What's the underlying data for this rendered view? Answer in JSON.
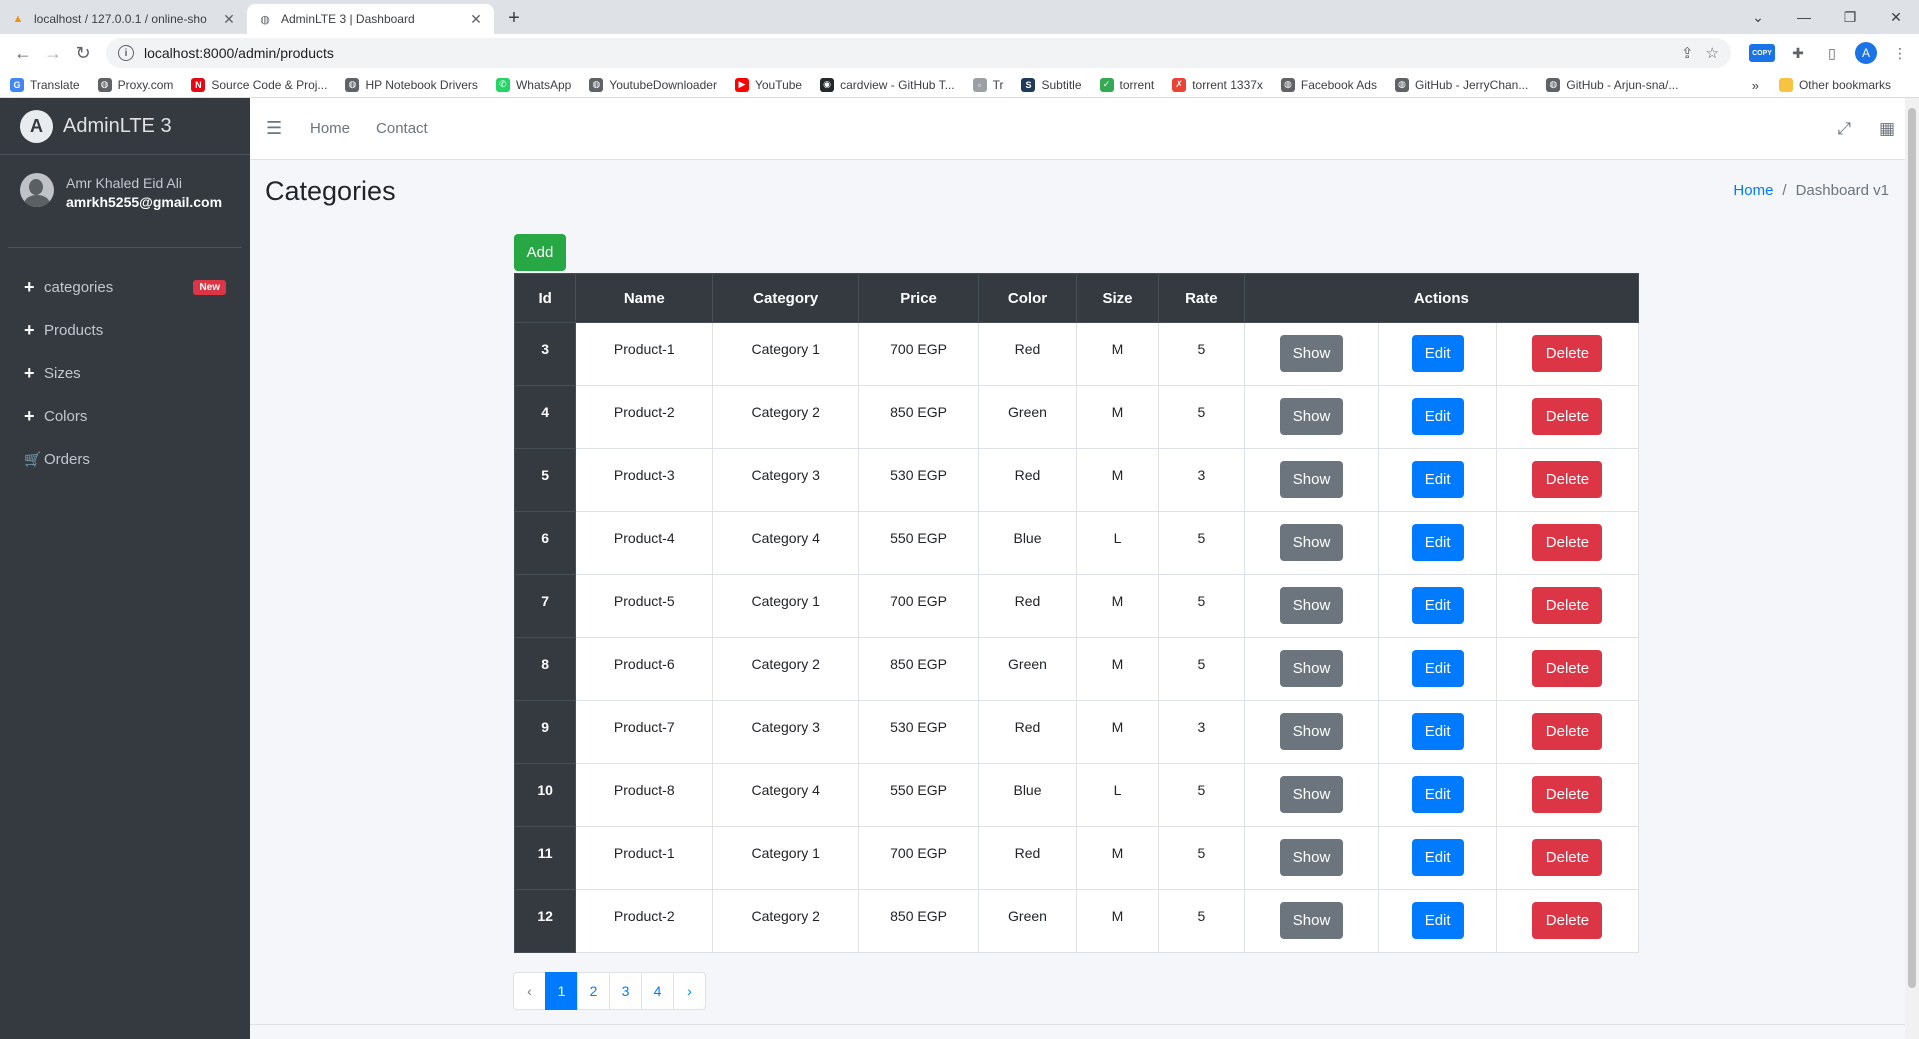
{
  "browser": {
    "tabs": [
      {
        "title": "localhost / 127.0.0.1 / online-sho",
        "active": false
      },
      {
        "title": "AdminLTE 3 | Dashboard",
        "active": true
      }
    ],
    "new_tab": "+",
    "url": "localhost:8000/admin/products",
    "bookmarks": [
      {
        "label": "Translate",
        "icon": "translate-icon",
        "color": "#4285f4"
      },
      {
        "label": "Proxy.com",
        "icon": "globe-icon",
        "color": "#5f6368"
      },
      {
        "label": "Source Code & Proj...",
        "icon": "netflix-icon",
        "color": "#e50914"
      },
      {
        "label": "HP Notebook Drivers",
        "icon": "globe-icon",
        "color": "#5f6368"
      },
      {
        "label": "WhatsApp",
        "icon": "whatsapp-icon",
        "color": "#25d366"
      },
      {
        "label": "YoutubeDownloader",
        "icon": "globe-icon",
        "color": "#5f6368"
      },
      {
        "label": "YouTube",
        "icon": "youtube-icon",
        "color": "#ff0000"
      },
      {
        "label": "cardview - GitHub T...",
        "icon": "github-icon",
        "color": "#24292e"
      },
      {
        "label": "Tr",
        "icon": "page-icon",
        "color": "#9aa0a6"
      },
      {
        "label": "Subtitle",
        "icon": "subtitle-icon",
        "color": "#1f3b57"
      },
      {
        "label": "torrent",
        "icon": "checkbox-icon",
        "color": "#34a853"
      },
      {
        "label": "torrent 1337x",
        "icon": "x-icon",
        "color": "#ea4335"
      },
      {
        "label": "Facebook Ads",
        "icon": "globe-icon",
        "color": "#5f6368"
      },
      {
        "label": "GitHub - JerryChan...",
        "icon": "globe-icon",
        "color": "#5f6368"
      },
      {
        "label": "GitHub - Arjun-sna/...",
        "icon": "globe-icon",
        "color": "#5f6368"
      }
    ],
    "bookmarks_more": "»",
    "other_bookmarks": "Other bookmarks",
    "profile_initial": "A",
    "copy_ext": "COPY"
  },
  "sidebar": {
    "brand": "AdminLTE 3",
    "brand_logo": "A",
    "user_name": "Amr Khaled Eid Ali",
    "user_email": "amrkh5255@gmail.com",
    "items": [
      {
        "label": "categories",
        "icon": "+",
        "badge": "New"
      },
      {
        "label": "Products",
        "icon": "+"
      },
      {
        "label": "Sizes",
        "icon": "+"
      },
      {
        "label": "Colors",
        "icon": "+"
      },
      {
        "label": "Orders",
        "icon": "🛒"
      }
    ]
  },
  "topnav": {
    "menu_icon": "☰",
    "links": [
      "Home",
      "Contact"
    ]
  },
  "page": {
    "title": "Categories",
    "breadcrumb": {
      "home": "Home",
      "separator": "/",
      "current": "Dashboard v1"
    },
    "add_label": "Add"
  },
  "table": {
    "headers": [
      "Id",
      "Name",
      "Category",
      "Price",
      "Color",
      "Size",
      "Rate",
      "Actions"
    ],
    "actions": {
      "show": "Show",
      "edit": "Edit",
      "delete": "Delete"
    },
    "rows": [
      {
        "id": "3",
        "name": "Product-1",
        "category": "Category 1",
        "price": "700 EGP",
        "color": "Red",
        "size": "M",
        "rate": "5"
      },
      {
        "id": "4",
        "name": "Product-2",
        "category": "Category 2",
        "price": "850 EGP",
        "color": "Green",
        "size": "M",
        "rate": "5"
      },
      {
        "id": "5",
        "name": "Product-3",
        "category": "Category 3",
        "price": "530 EGP",
        "color": "Red",
        "size": "M",
        "rate": "3"
      },
      {
        "id": "6",
        "name": "Product-4",
        "category": "Category 4",
        "price": "550 EGP",
        "color": "Blue",
        "size": "L",
        "rate": "5"
      },
      {
        "id": "7",
        "name": "Product-5",
        "category": "Category 1",
        "price": "700 EGP",
        "color": "Red",
        "size": "M",
        "rate": "5"
      },
      {
        "id": "8",
        "name": "Product-6",
        "category": "Category 2",
        "price": "850 EGP",
        "color": "Green",
        "size": "M",
        "rate": "5"
      },
      {
        "id": "9",
        "name": "Product-7",
        "category": "Category 3",
        "price": "530 EGP",
        "color": "Red",
        "size": "M",
        "rate": "3"
      },
      {
        "id": "10",
        "name": "Product-8",
        "category": "Category 4",
        "price": "550 EGP",
        "color": "Blue",
        "size": "L",
        "rate": "5"
      },
      {
        "id": "11",
        "name": "Product-1",
        "category": "Category 1",
        "price": "700 EGP",
        "color": "Red",
        "size": "M",
        "rate": "5"
      },
      {
        "id": "12",
        "name": "Product-2",
        "category": "Category 2",
        "price": "850 EGP",
        "color": "Green",
        "size": "M",
        "rate": "5"
      }
    ]
  },
  "pagination": {
    "prev": "‹",
    "pages": [
      "1",
      "2",
      "3",
      "4"
    ],
    "current": "1",
    "next": "›"
  },
  "colors": {
    "sidebar_bg": "#343a40",
    "primary": "#007bff",
    "success": "#28a745",
    "danger": "#dc3545",
    "secondary": "#6c757d"
  }
}
